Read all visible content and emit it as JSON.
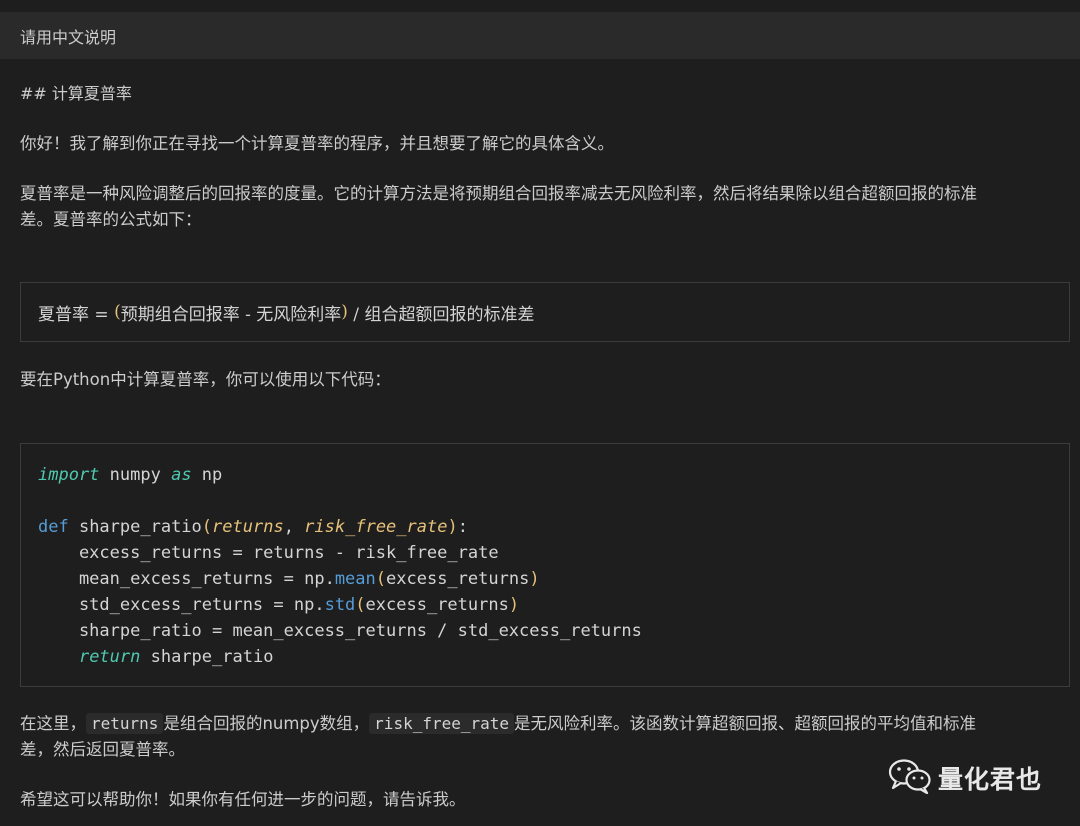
{
  "prompt": {
    "text": "请用中文说明"
  },
  "response": {
    "heading": "## 计算夏普率",
    "para1": "你好！我了解到你正在寻找一个计算夏普率的程序，并且想要了解它的具体含义。",
    "para2_line1": "夏普率是一种风险调整后的回报率的度量。它的计算方法是将预期组合回报率减去无风险利率，然后将结果除以组合超额回报的标准",
    "para2_line2": "差。夏普率的公式如下：",
    "formula": {
      "lhs": "夏普率 = ",
      "open": "(",
      "inner": "预期组合回报率 - 无风险利率",
      "close": ")",
      "rhs": " / 组合超额回报的标准差"
    },
    "para3": "要在Python中计算夏普率，你可以使用以下代码：",
    "code": {
      "l1_kw": "import",
      "l1_mod": " numpy ",
      "l1_as": "as",
      "l1_alias": " np",
      "l3_def": "def",
      "l3_name": " sharpe_ratio",
      "l3_open": "(",
      "l3_p1": "returns",
      "l3_comma": ", ",
      "l3_p2": "risk_free_rate",
      "l3_close": ")",
      "l3_colon": ":",
      "l4": "    excess_returns = returns - risk_free_rate",
      "l5_a": "    mean_excess_returns = np.",
      "l5_fn": "mean",
      "l5_open": "(",
      "l5_arg": "excess_returns",
      "l5_close": ")",
      "l6_a": "    std_excess_returns = np.",
      "l6_fn": "std",
      "l6_open": "(",
      "l6_arg": "excess_returns",
      "l6_close": ")",
      "l7": "    sharpe_ratio = mean_excess_returns / std_excess_returns",
      "l8_indent": "    ",
      "l8_kw": "return",
      "l8_val": " sharpe_ratio"
    },
    "para4_pre": "在这里，",
    "para4_code1": "returns",
    "para4_mid": "是组合回报的numpy数组，",
    "para4_code2": "risk_free_rate",
    "para4_post": "是无风险利率。该函数计算超额回报、超额回报的平均值和标准",
    "para4_line2": "差，然后返回夏普率。",
    "para5": "希望这可以帮助你！如果你有任何进一步的问题，请告诉我。"
  },
  "watermark": {
    "text": "量化君也",
    "icon": "wechat-icon"
  }
}
